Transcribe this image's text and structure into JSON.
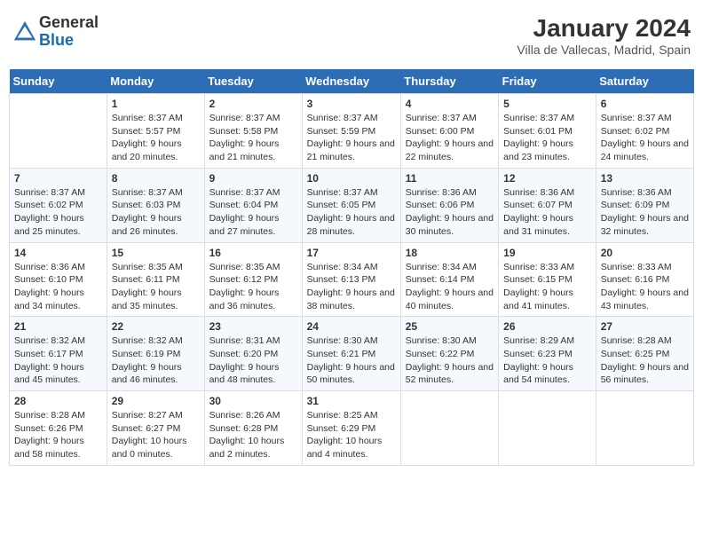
{
  "header": {
    "logo_general": "General",
    "logo_blue": "Blue",
    "month_year": "January 2024",
    "location": "Villa de Vallecas, Madrid, Spain"
  },
  "weekdays": [
    "Sunday",
    "Monday",
    "Tuesday",
    "Wednesday",
    "Thursday",
    "Friday",
    "Saturday"
  ],
  "weeks": [
    [
      {
        "day": "",
        "sunrise": "",
        "sunset": "",
        "daylight": ""
      },
      {
        "day": "1",
        "sunrise": "Sunrise: 8:37 AM",
        "sunset": "Sunset: 5:57 PM",
        "daylight": "Daylight: 9 hours and 20 minutes."
      },
      {
        "day": "2",
        "sunrise": "Sunrise: 8:37 AM",
        "sunset": "Sunset: 5:58 PM",
        "daylight": "Daylight: 9 hours and 21 minutes."
      },
      {
        "day": "3",
        "sunrise": "Sunrise: 8:37 AM",
        "sunset": "Sunset: 5:59 PM",
        "daylight": "Daylight: 9 hours and 21 minutes."
      },
      {
        "day": "4",
        "sunrise": "Sunrise: 8:37 AM",
        "sunset": "Sunset: 6:00 PM",
        "daylight": "Daylight: 9 hours and 22 minutes."
      },
      {
        "day": "5",
        "sunrise": "Sunrise: 8:37 AM",
        "sunset": "Sunset: 6:01 PM",
        "daylight": "Daylight: 9 hours and 23 minutes."
      },
      {
        "day": "6",
        "sunrise": "Sunrise: 8:37 AM",
        "sunset": "Sunset: 6:02 PM",
        "daylight": "Daylight: 9 hours and 24 minutes."
      }
    ],
    [
      {
        "day": "7",
        "sunrise": "Sunrise: 8:37 AM",
        "sunset": "Sunset: 6:02 PM",
        "daylight": "Daylight: 9 hours and 25 minutes."
      },
      {
        "day": "8",
        "sunrise": "Sunrise: 8:37 AM",
        "sunset": "Sunset: 6:03 PM",
        "daylight": "Daylight: 9 hours and 26 minutes."
      },
      {
        "day": "9",
        "sunrise": "Sunrise: 8:37 AM",
        "sunset": "Sunset: 6:04 PM",
        "daylight": "Daylight: 9 hours and 27 minutes."
      },
      {
        "day": "10",
        "sunrise": "Sunrise: 8:37 AM",
        "sunset": "Sunset: 6:05 PM",
        "daylight": "Daylight: 9 hours and 28 minutes."
      },
      {
        "day": "11",
        "sunrise": "Sunrise: 8:36 AM",
        "sunset": "Sunset: 6:06 PM",
        "daylight": "Daylight: 9 hours and 30 minutes."
      },
      {
        "day": "12",
        "sunrise": "Sunrise: 8:36 AM",
        "sunset": "Sunset: 6:07 PM",
        "daylight": "Daylight: 9 hours and 31 minutes."
      },
      {
        "day": "13",
        "sunrise": "Sunrise: 8:36 AM",
        "sunset": "Sunset: 6:09 PM",
        "daylight": "Daylight: 9 hours and 32 minutes."
      }
    ],
    [
      {
        "day": "14",
        "sunrise": "Sunrise: 8:36 AM",
        "sunset": "Sunset: 6:10 PM",
        "daylight": "Daylight: 9 hours and 34 minutes."
      },
      {
        "day": "15",
        "sunrise": "Sunrise: 8:35 AM",
        "sunset": "Sunset: 6:11 PM",
        "daylight": "Daylight: 9 hours and 35 minutes."
      },
      {
        "day": "16",
        "sunrise": "Sunrise: 8:35 AM",
        "sunset": "Sunset: 6:12 PM",
        "daylight": "Daylight: 9 hours and 36 minutes."
      },
      {
        "day": "17",
        "sunrise": "Sunrise: 8:34 AM",
        "sunset": "Sunset: 6:13 PM",
        "daylight": "Daylight: 9 hours and 38 minutes."
      },
      {
        "day": "18",
        "sunrise": "Sunrise: 8:34 AM",
        "sunset": "Sunset: 6:14 PM",
        "daylight": "Daylight: 9 hours and 40 minutes."
      },
      {
        "day": "19",
        "sunrise": "Sunrise: 8:33 AM",
        "sunset": "Sunset: 6:15 PM",
        "daylight": "Daylight: 9 hours and 41 minutes."
      },
      {
        "day": "20",
        "sunrise": "Sunrise: 8:33 AM",
        "sunset": "Sunset: 6:16 PM",
        "daylight": "Daylight: 9 hours and 43 minutes."
      }
    ],
    [
      {
        "day": "21",
        "sunrise": "Sunrise: 8:32 AM",
        "sunset": "Sunset: 6:17 PM",
        "daylight": "Daylight: 9 hours and 45 minutes."
      },
      {
        "day": "22",
        "sunrise": "Sunrise: 8:32 AM",
        "sunset": "Sunset: 6:19 PM",
        "daylight": "Daylight: 9 hours and 46 minutes."
      },
      {
        "day": "23",
        "sunrise": "Sunrise: 8:31 AM",
        "sunset": "Sunset: 6:20 PM",
        "daylight": "Daylight: 9 hours and 48 minutes."
      },
      {
        "day": "24",
        "sunrise": "Sunrise: 8:30 AM",
        "sunset": "Sunset: 6:21 PM",
        "daylight": "Daylight: 9 hours and 50 minutes."
      },
      {
        "day": "25",
        "sunrise": "Sunrise: 8:30 AM",
        "sunset": "Sunset: 6:22 PM",
        "daylight": "Daylight: 9 hours and 52 minutes."
      },
      {
        "day": "26",
        "sunrise": "Sunrise: 8:29 AM",
        "sunset": "Sunset: 6:23 PM",
        "daylight": "Daylight: 9 hours and 54 minutes."
      },
      {
        "day": "27",
        "sunrise": "Sunrise: 8:28 AM",
        "sunset": "Sunset: 6:25 PM",
        "daylight": "Daylight: 9 hours and 56 minutes."
      }
    ],
    [
      {
        "day": "28",
        "sunrise": "Sunrise: 8:28 AM",
        "sunset": "Sunset: 6:26 PM",
        "daylight": "Daylight: 9 hours and 58 minutes."
      },
      {
        "day": "29",
        "sunrise": "Sunrise: 8:27 AM",
        "sunset": "Sunset: 6:27 PM",
        "daylight": "Daylight: 10 hours and 0 minutes."
      },
      {
        "day": "30",
        "sunrise": "Sunrise: 8:26 AM",
        "sunset": "Sunset: 6:28 PM",
        "daylight": "Daylight: 10 hours and 2 minutes."
      },
      {
        "day": "31",
        "sunrise": "Sunrise: 8:25 AM",
        "sunset": "Sunset: 6:29 PM",
        "daylight": "Daylight: 10 hours and 4 minutes."
      },
      {
        "day": "",
        "sunrise": "",
        "sunset": "",
        "daylight": ""
      },
      {
        "day": "",
        "sunrise": "",
        "sunset": "",
        "daylight": ""
      },
      {
        "day": "",
        "sunrise": "",
        "sunset": "",
        "daylight": ""
      }
    ]
  ]
}
